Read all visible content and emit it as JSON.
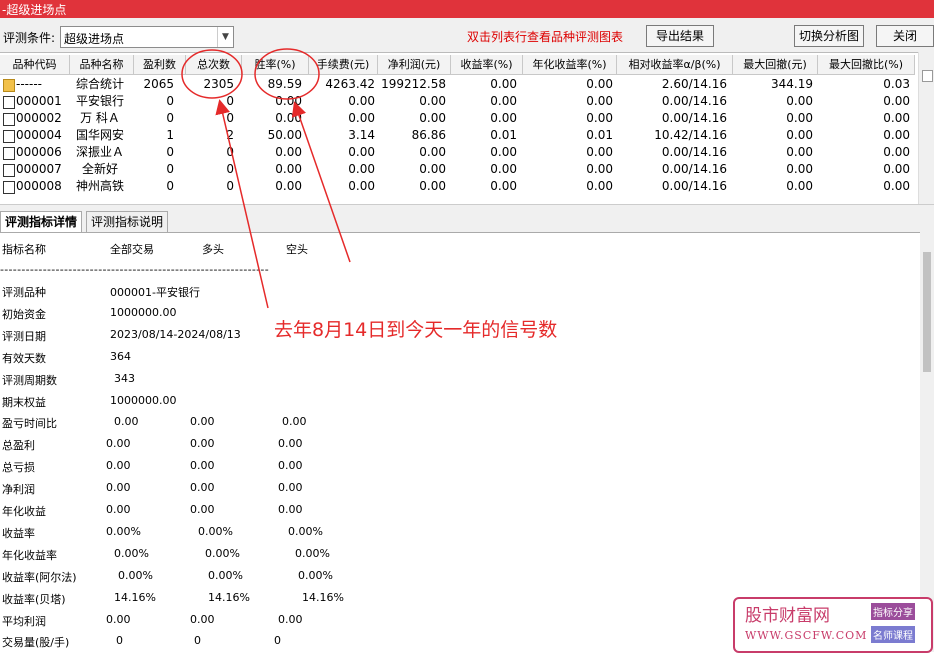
{
  "window": {
    "title": "-超级进场点"
  },
  "filter": {
    "label": "评测条件:",
    "value": "超级进场点",
    "hint": "双击列表行查看品种评测图表",
    "buttons": {
      "export": "导出结果",
      "switch_chart": "切换分析图",
      "close": "关闭"
    }
  },
  "grid": {
    "headers": [
      "品种代码",
      "品种名称",
      "盈利数",
      "总次数",
      "胜率(%)",
      "手续费(元)",
      "净利润(元)",
      "收益率(%)",
      "年化收益率(%)",
      "相对收益率α/β(%)",
      "最大回撤(元)",
      "最大回撤比(%)"
    ],
    "rows": [
      [
        "------",
        "综合统计",
        "2065",
        "2305",
        "89.59",
        "4263.42",
        "199212.58",
        "0.00",
        "0.00",
        "2.60/14.16",
        "344.19",
        "0.03"
      ],
      [
        "000001",
        "平安银行",
        "0",
        "0",
        "0.00",
        "0.00",
        "0.00",
        "0.00",
        "0.00",
        "0.00/14.16",
        "0.00",
        "0.00"
      ],
      [
        "000002",
        "万 科Ａ",
        "0",
        "0",
        "0.00",
        "0.00",
        "0.00",
        "0.00",
        "0.00",
        "0.00/14.16",
        "0.00",
        "0.00"
      ],
      [
        "000004",
        "国华网安",
        "1",
        "2",
        "50.00",
        "3.14",
        "86.86",
        "0.01",
        "0.01",
        "10.42/14.16",
        "0.00",
        "0.00"
      ],
      [
        "000006",
        "深振业Ａ",
        "0",
        "0",
        "0.00",
        "0.00",
        "0.00",
        "0.00",
        "0.00",
        "0.00/14.16",
        "0.00",
        "0.00"
      ],
      [
        "000007",
        "全新好",
        "0",
        "0",
        "0.00",
        "0.00",
        "0.00",
        "0.00",
        "0.00",
        "0.00/14.16",
        "0.00",
        "0.00"
      ],
      [
        "000008",
        "神州高铁",
        "0",
        "0",
        "0.00",
        "0.00",
        "0.00",
        "0.00",
        "0.00",
        "0.00/14.16",
        "0.00",
        "0.00"
      ]
    ]
  },
  "tabs": [
    "评测指标详情",
    "评测指标说明"
  ],
  "detail": {
    "columns": [
      "指标名称",
      "全部交易",
      "多头",
      "空头"
    ],
    "divider": "---------------------------------------------------------------",
    "info": [
      {
        "label": "评测品种",
        "value": "000001-平安银行"
      },
      {
        "label": "初始资金",
        "value": "1000000.00"
      },
      {
        "label": "评测日期",
        "value": "2023/08/14-2024/08/13"
      },
      {
        "label": "有效天数",
        "value": "364"
      },
      {
        "label": "评测周期数",
        "value": "343"
      },
      {
        "label": "期末权益",
        "value": "1000000.00"
      }
    ],
    "metrics": [
      {
        "label": "盈亏时间比",
        "all": "0.00",
        "long": "0.00",
        "short": "0.00"
      },
      {
        "label": "总盈利",
        "all": "0.00",
        "long": "0.00",
        "short": "0.00"
      },
      {
        "label": "总亏损",
        "all": "0.00",
        "long": "0.00",
        "short": "0.00"
      },
      {
        "label": "净利润",
        "all": "0.00",
        "long": "0.00",
        "short": "0.00"
      },
      {
        "label": "年化收益",
        "all": "0.00",
        "long": "0.00",
        "short": "0.00"
      },
      {
        "label": "收益率",
        "all": "0.00%",
        "long": "0.00%",
        "short": "0.00%"
      },
      {
        "label": "年化收益率",
        "all": "0.00%",
        "long": "0.00%",
        "short": "0.00%"
      },
      {
        "label": "收益率(阿尔法)",
        "all": "0.00%",
        "long": "0.00%",
        "short": "0.00%"
      },
      {
        "label": "收益率(贝塔)",
        "all": "14.16%",
        "long": "14.16%",
        "short": "14.16%"
      },
      {
        "label": "平均利润",
        "all": "0.00",
        "long": "0.00",
        "short": "0.00"
      },
      {
        "label": "交易量(股/手)",
        "all": "0",
        "long": "0",
        "short": "0"
      }
    ]
  },
  "annotation": {
    "text": "去年8月14日到今天一年的信号数"
  },
  "watermark": {
    "name": "股市财富网",
    "url": "WWW.GSCFW.COM",
    "tag1": "指标分享",
    "tag2": "名师课程"
  },
  "colors": {
    "titlebar": "#e0333b",
    "hint": "#dd0000",
    "annotation": "#e52a2a",
    "logo": "#c83c6a"
  }
}
